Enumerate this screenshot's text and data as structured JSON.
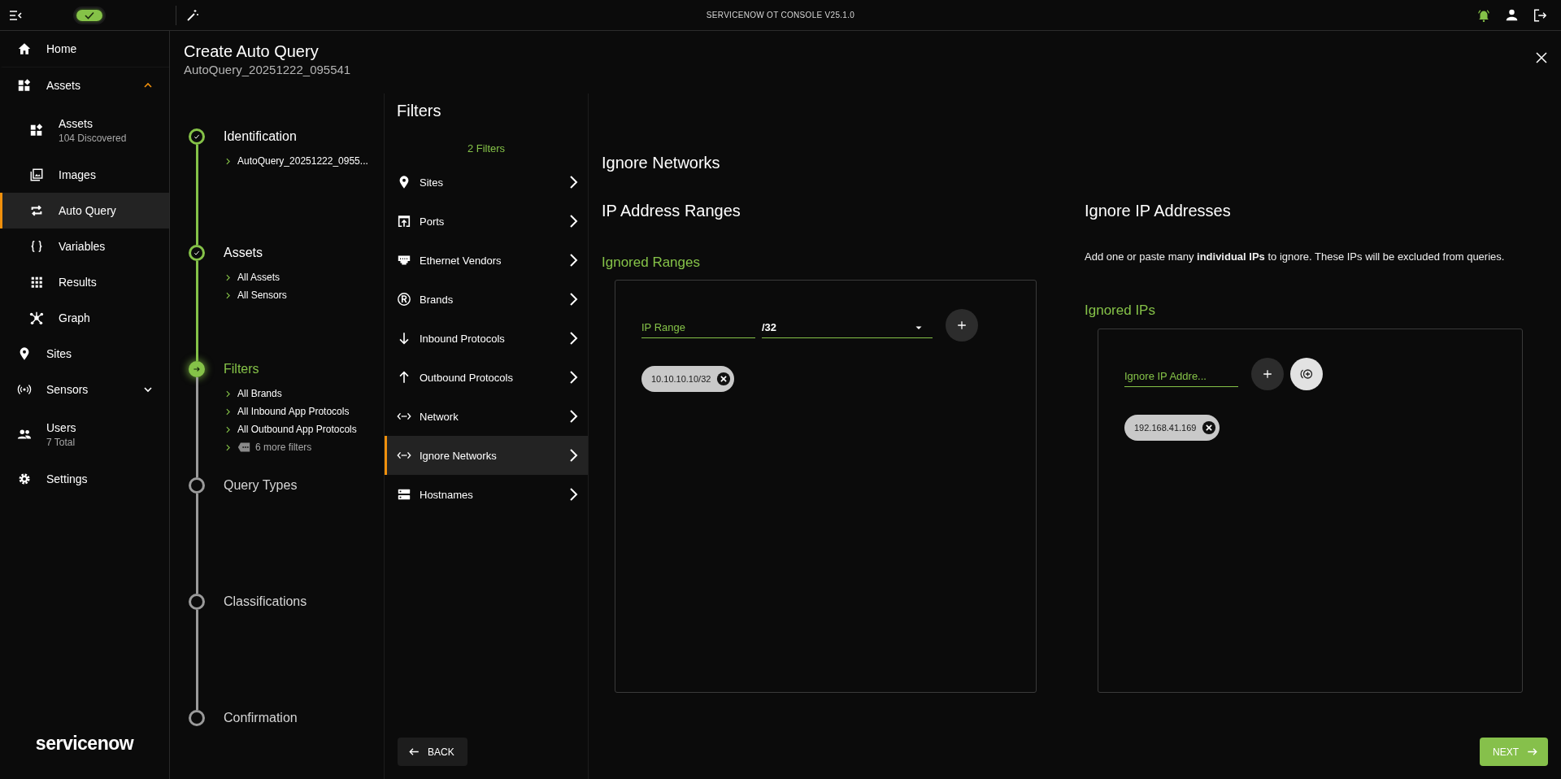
{
  "topbar": {
    "toggle_on": true,
    "title": "SERVICENOW OT CONSOLE V25.1.0"
  },
  "nav": {
    "items": [
      {
        "label": "Home",
        "selected": false
      },
      {
        "label": "Assets",
        "selected": false,
        "expanded": true,
        "children": [
          {
            "label": "Assets",
            "sub": "104 Discovered",
            "selected": false
          },
          {
            "label": "Images",
            "selected": false
          },
          {
            "label": "Auto Query",
            "selected": true
          },
          {
            "label": "Variables",
            "selected": false
          },
          {
            "label": "Results",
            "selected": false
          },
          {
            "label": "Graph",
            "selected": false
          }
        ]
      },
      {
        "label": "Sites",
        "selected": false
      },
      {
        "label": "Sensors",
        "selected": false,
        "expanded": false
      },
      {
        "label": "Users",
        "sub": "7 Total",
        "selected": false
      },
      {
        "label": "Settings",
        "selected": false
      }
    ],
    "logo": "servicenow"
  },
  "header": {
    "title": "Create Auto Query",
    "subtitle": "AutoQuery_20251222_095541"
  },
  "steps": [
    {
      "title": "Identification",
      "completed": true,
      "selected": false,
      "details": [
        {
          "text": "AutoQuery_20251222_0955...",
          "kind": "link"
        }
      ]
    },
    {
      "title": "Assets",
      "completed": true,
      "selected": false,
      "details": [
        {
          "text": "All Assets",
          "kind": "link"
        },
        {
          "text": "All Sensors",
          "kind": "link"
        }
      ]
    },
    {
      "title": "Filters",
      "completed": false,
      "selected": true,
      "details": [
        {
          "text": "All Brands",
          "kind": "link"
        },
        {
          "text": "All Inbound App Protocols",
          "kind": "link"
        },
        {
          "text": "All Outbound App Protocols",
          "kind": "link"
        },
        {
          "text": "6 more filters",
          "kind": "more"
        }
      ]
    },
    {
      "title": "Query Types",
      "completed": false,
      "selected": false
    },
    {
      "title": "Classifications",
      "completed": false,
      "selected": false
    },
    {
      "title": "Confirmation",
      "completed": false,
      "selected": false
    }
  ],
  "filters": {
    "title": "Filters",
    "count": "2 Filters",
    "items": [
      {
        "label": "Sites",
        "selected": false
      },
      {
        "label": "Ports",
        "selected": false
      },
      {
        "label": "Ethernet Vendors",
        "selected": false
      },
      {
        "label": "Brands",
        "selected": false
      },
      {
        "label": "Inbound Protocols",
        "selected": false
      },
      {
        "label": "Outbound Protocols",
        "selected": false
      },
      {
        "label": "Network",
        "selected": false
      },
      {
        "label": "Ignore Networks",
        "selected": true
      },
      {
        "label": "Hostnames",
        "selected": false
      }
    ]
  },
  "content": {
    "title": "Ignore Networks",
    "ranges": {
      "title": "IP Address Ranges",
      "subtitle": "Ignored Ranges",
      "placeholder": "IP Range",
      "mask": "/32",
      "chips": [
        "10.10.10.10/32"
      ]
    },
    "ips": {
      "title": "Ignore IP Addresses",
      "description": "Add one or paste many **individual IPs** to ignore. These IPs will be excluded from queries.",
      "subtitle": "Ignored IPs",
      "placeholder": "Ignore IP Addre...",
      "chips": [
        "192.168.41.169"
      ]
    }
  },
  "footer": {
    "back": "BACK",
    "next": "NEXT"
  }
}
